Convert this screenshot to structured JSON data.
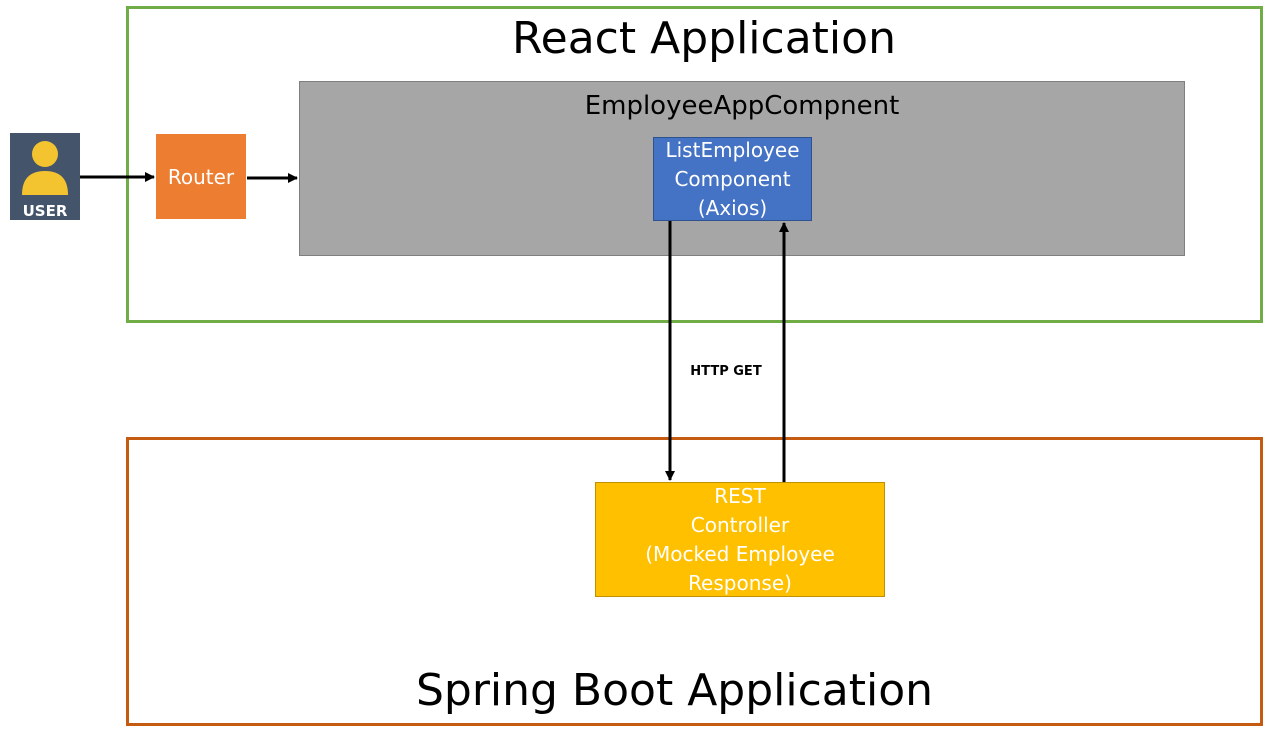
{
  "react_app": {
    "title": "React Application",
    "container": {
      "title": "EmployeeAppCompnent",
      "list_component": {
        "lines": [
          "ListEmployee",
          "Component",
          "(Axios)"
        ]
      }
    }
  },
  "user": {
    "label": "USER"
  },
  "router": {
    "label": "Router"
  },
  "connection": {
    "label": "HTTP GET"
  },
  "spring_app": {
    "title": "Spring Boot Application",
    "rest_controller": {
      "lines": [
        "REST",
        "Controller",
        "(Mocked Employee",
        "Response)"
      ]
    }
  },
  "colors": {
    "react_border": "#70ad47",
    "container_fill": "#a6a6a6",
    "list_component_fill": "#4472c4",
    "user_fill": "#44546a",
    "user_icon": "#f4c430",
    "router_fill": "#ed7d31",
    "spring_border": "#c55a11",
    "rest_fill": "#ffc000"
  },
  "icons": {
    "user": "person-icon"
  }
}
